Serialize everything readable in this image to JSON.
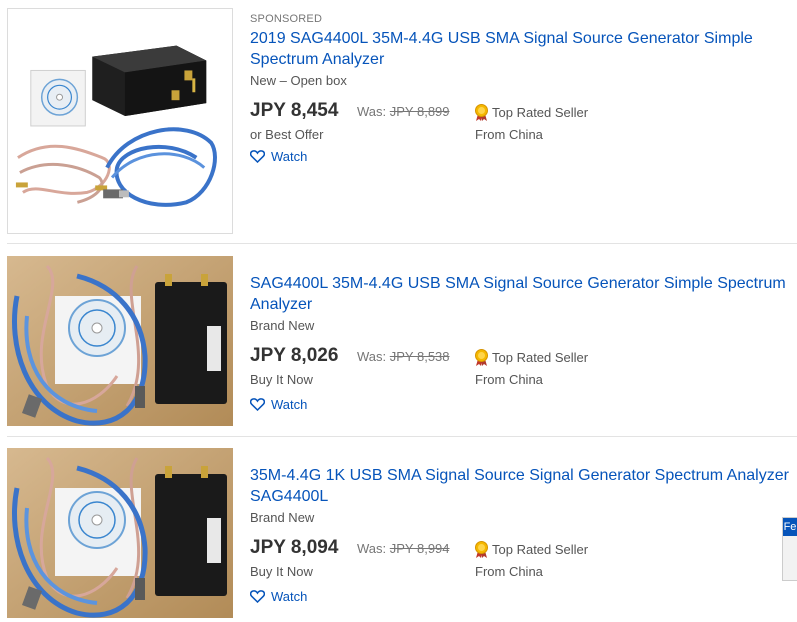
{
  "listings": [
    {
      "sponsored": "SPONSORED",
      "title": "2019 SAG4400L 35M-4.4G USB SMA Signal Source Generator Simple Spectrum Analyzer",
      "condition": "New – Open box",
      "price": "JPY 8,454",
      "was_label": "Was:",
      "was_price": "JPY 8,899",
      "badge": "Top Rated Seller",
      "buy_format": "or Best Offer",
      "location": "From China",
      "watch": "Watch"
    },
    {
      "title": "SAG4400L 35M-4.4G USB SMA Signal Source Generator Simple Spectrum Analyzer",
      "condition": "Brand New",
      "price": "JPY 8,026",
      "was_label": "Was:",
      "was_price": "JPY 8,538",
      "badge": "Top Rated Seller",
      "buy_format": "Buy It Now",
      "location": "From China",
      "watch": "Watch"
    },
    {
      "title": "35M-4.4G 1K USB SMA Signal Source Signal Generator Spectrum Analyzer SAG4400L",
      "condition": "Brand New",
      "price": "JPY 8,094",
      "was_label": "Was:",
      "was_price": "JPY 8,994",
      "badge": "Top Rated Seller",
      "buy_format": "Buy It Now",
      "location": "From China",
      "watch": "Watch"
    }
  ],
  "feedback_tab": {
    "label": "Fe"
  },
  "colors": {
    "link": "#0654ba",
    "price": "#333333",
    "muted": "#767676",
    "divider": "#e3e3e3",
    "photo_background": "#c9a16a"
  },
  "icons": {
    "watch": "heart-outline-icon",
    "badge": "top-rated-medal-icon"
  }
}
